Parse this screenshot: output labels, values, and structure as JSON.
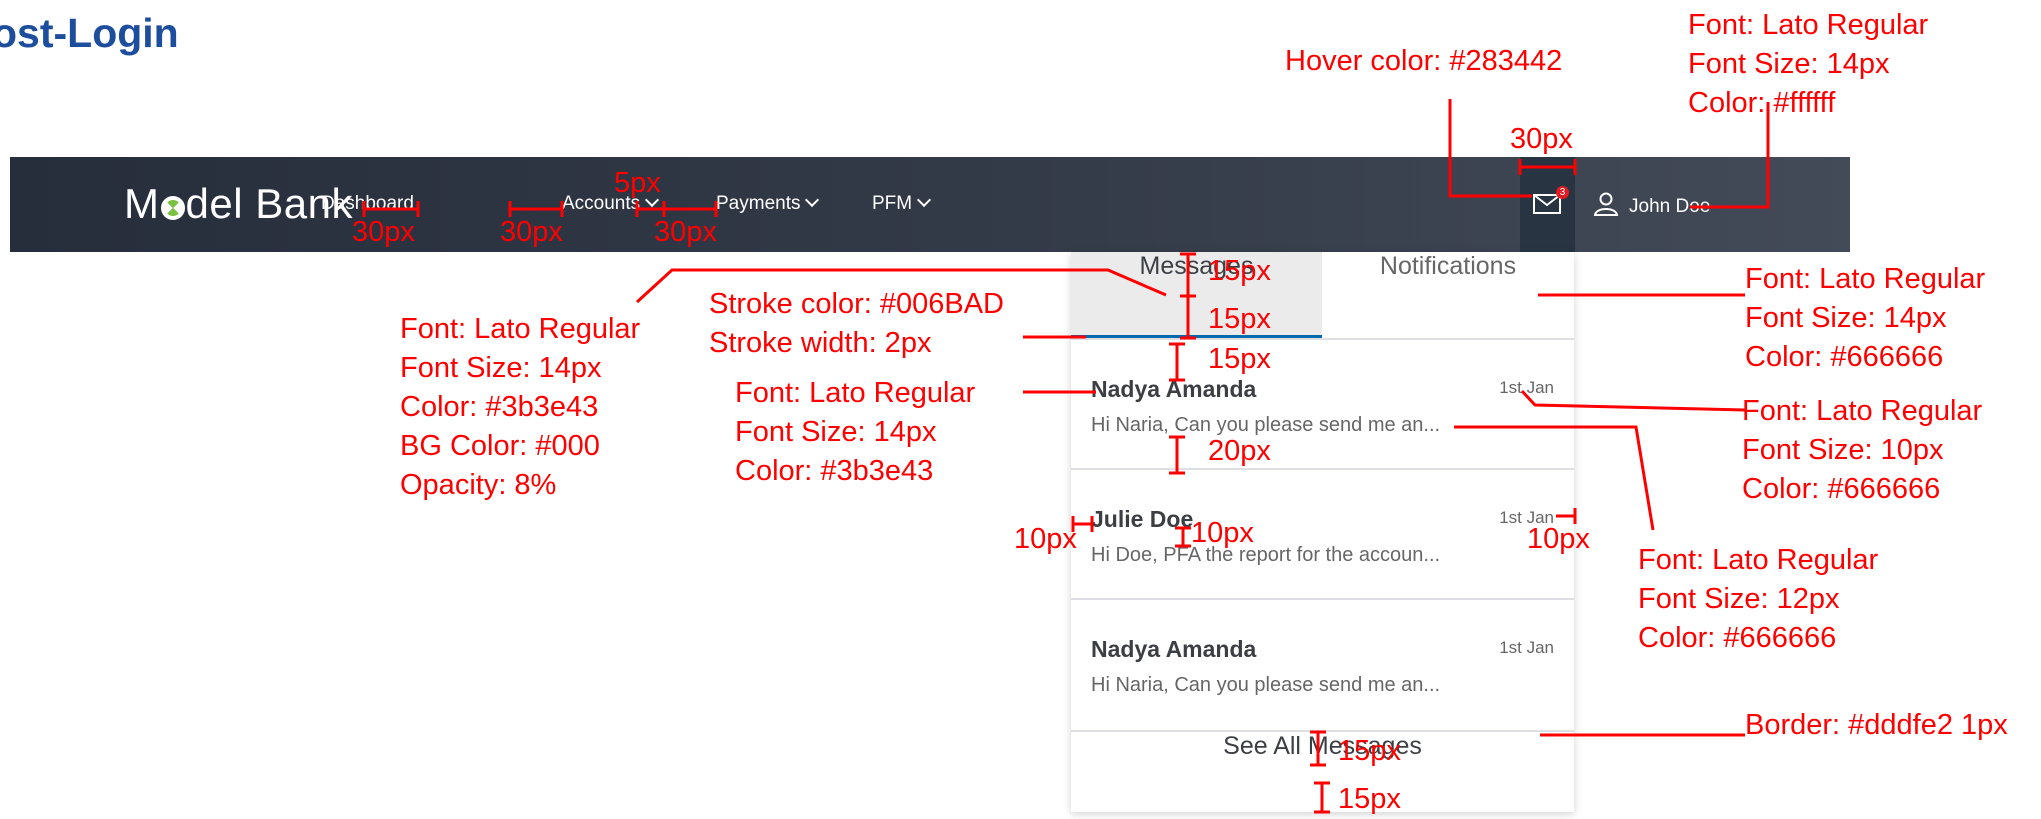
{
  "page_title": "ost-Login",
  "navbar": {
    "brand": {
      "pre": "M",
      "post": "del Bank"
    },
    "items": [
      {
        "label": "Dashboard",
        "has_chevron": false
      },
      {
        "label": "Accounts",
        "has_chevron": true
      },
      {
        "label": "Payments",
        "has_chevron": true
      },
      {
        "label": "PFM",
        "has_chevron": true
      }
    ],
    "messages_badge": "3",
    "user_name": "John Doe"
  },
  "dropdown": {
    "tabs": {
      "messages": "Messages",
      "notifications": "Notifications"
    },
    "messages": [
      {
        "sender": "Nadya Amanda",
        "date": "1st Jan",
        "preview": "Hi Naria, Can you please send me an..."
      },
      {
        "sender": "Julie Doe",
        "date": "1st Jan",
        "preview": "Hi Doe, PFA the report for the accoun..."
      },
      {
        "sender": "Nadya Amanda",
        "date": "1st Jan",
        "preview": "Hi Naria, Can you please send me an..."
      }
    ],
    "see_all": "See All Messages"
  },
  "annotations": {
    "hover": "Hover color: #283442",
    "user_spec": [
      "Font: Lato Regular",
      "Font Size: 14px",
      "Color: #ffffff"
    ],
    "tab_spec": [
      "Font: Lato Regular",
      "Font Size: 14px",
      "Color: #3b3e43",
      "BG Color: #000",
      "Opacity: 8%"
    ],
    "stroke_spec": [
      "Stroke color: #006BAD",
      "Stroke width: 2px"
    ],
    "sender_spec": [
      "Font: Lato Regular",
      "Font Size: 14px",
      "Color: #3b3e43"
    ],
    "notif_spec": [
      "Font: Lato Regular",
      "Font Size: 14px",
      "Color: #666666"
    ],
    "date_spec": [
      "Font: Lato Regular",
      "Font Size: 10px",
      "Color: #666666"
    ],
    "preview_spec": [
      "Font: Lato Regular",
      "Font Size: 12px",
      "Color: #666666"
    ],
    "border_spec": "Border: #dddfe2 1px",
    "gap_30px": "30px",
    "gap_5px": "5px",
    "gap_15px": "15px",
    "gap_20px": "20px",
    "gap_10px": "10px"
  },
  "colors": {
    "accent": "#006BAD",
    "hover": "#283442",
    "annotation": "#ff0000",
    "title": "#1d4e9e"
  }
}
